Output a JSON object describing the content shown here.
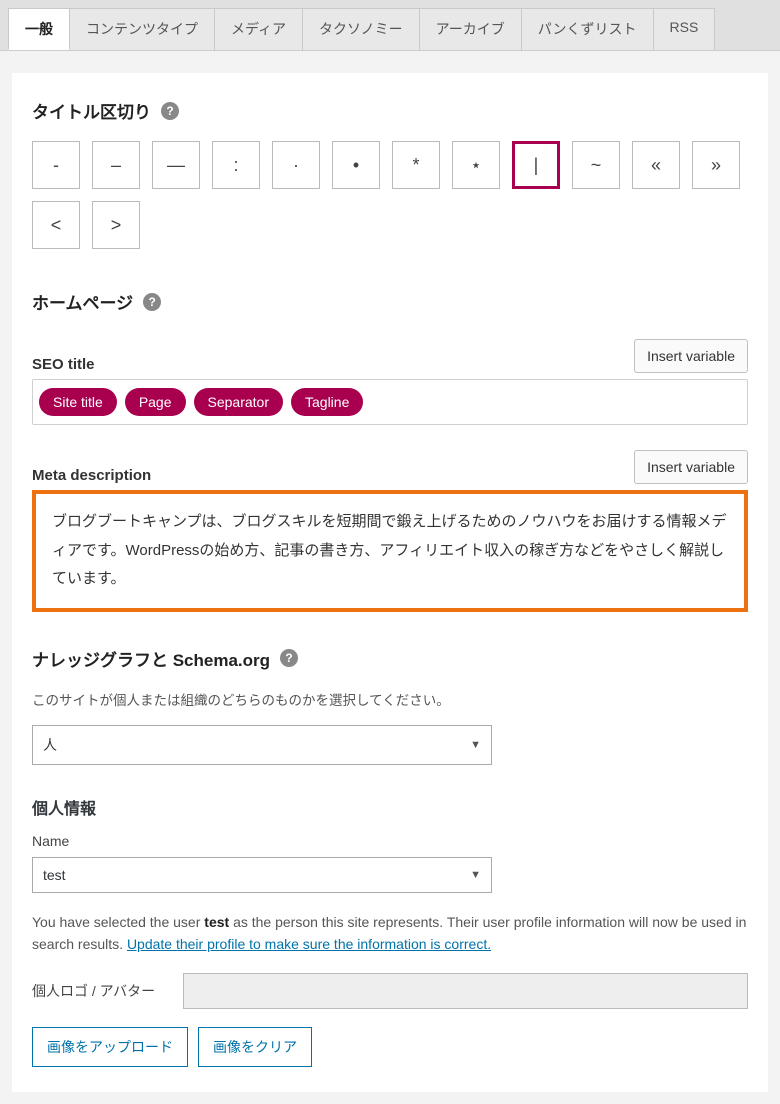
{
  "tabs": [
    {
      "label": "一般",
      "active": true
    },
    {
      "label": "コンテンツタイプ"
    },
    {
      "label": "メディア"
    },
    {
      "label": "タクソノミー"
    },
    {
      "label": "アーカイブ"
    },
    {
      "label": "パンくずリスト"
    },
    {
      "label": "RSS"
    }
  ],
  "section_title_separator": "タイトル区切り",
  "separators": [
    "-",
    "–",
    "—",
    ":",
    "·",
    "•",
    "*",
    "⋆",
    "|",
    "~",
    "«",
    "»",
    "<",
    ">"
  ],
  "separator_selected_index": 8,
  "section_homepage": "ホームページ",
  "seo_title": {
    "label": "SEO title",
    "insert_btn": "Insert variable",
    "pills": [
      "Site title",
      "Page",
      "Separator",
      "Tagline"
    ]
  },
  "meta_description": {
    "label": "Meta description",
    "insert_btn": "Insert variable",
    "value": "ブログブートキャンプは、ブログスキルを短期間で鍛え上げるためのノウハウをお届けする情報メディアです。WordPressの始め方、記事の書き方、アフィリエイト収入の稼ぎ方などをやさしく解説しています。"
  },
  "knowledge_graph": {
    "title": "ナレッジグラフと Schema.org",
    "hint": "このサイトが個人または組織のどちらのものかを選択してください。",
    "select_value": "人"
  },
  "personal_info": {
    "title": "個人情報",
    "name_label": "Name",
    "name_value": "test",
    "note_pre": "You have selected the user ",
    "note_bold": "test",
    "note_mid": " as the person this site represents. Their user profile information will now be used in search results. ",
    "note_link": "Update their profile to make sure the information is correct.",
    "logo_label": "個人ロゴ / アバター",
    "upload_btn": "画像をアップロード",
    "clear_btn": "画像をクリア"
  }
}
